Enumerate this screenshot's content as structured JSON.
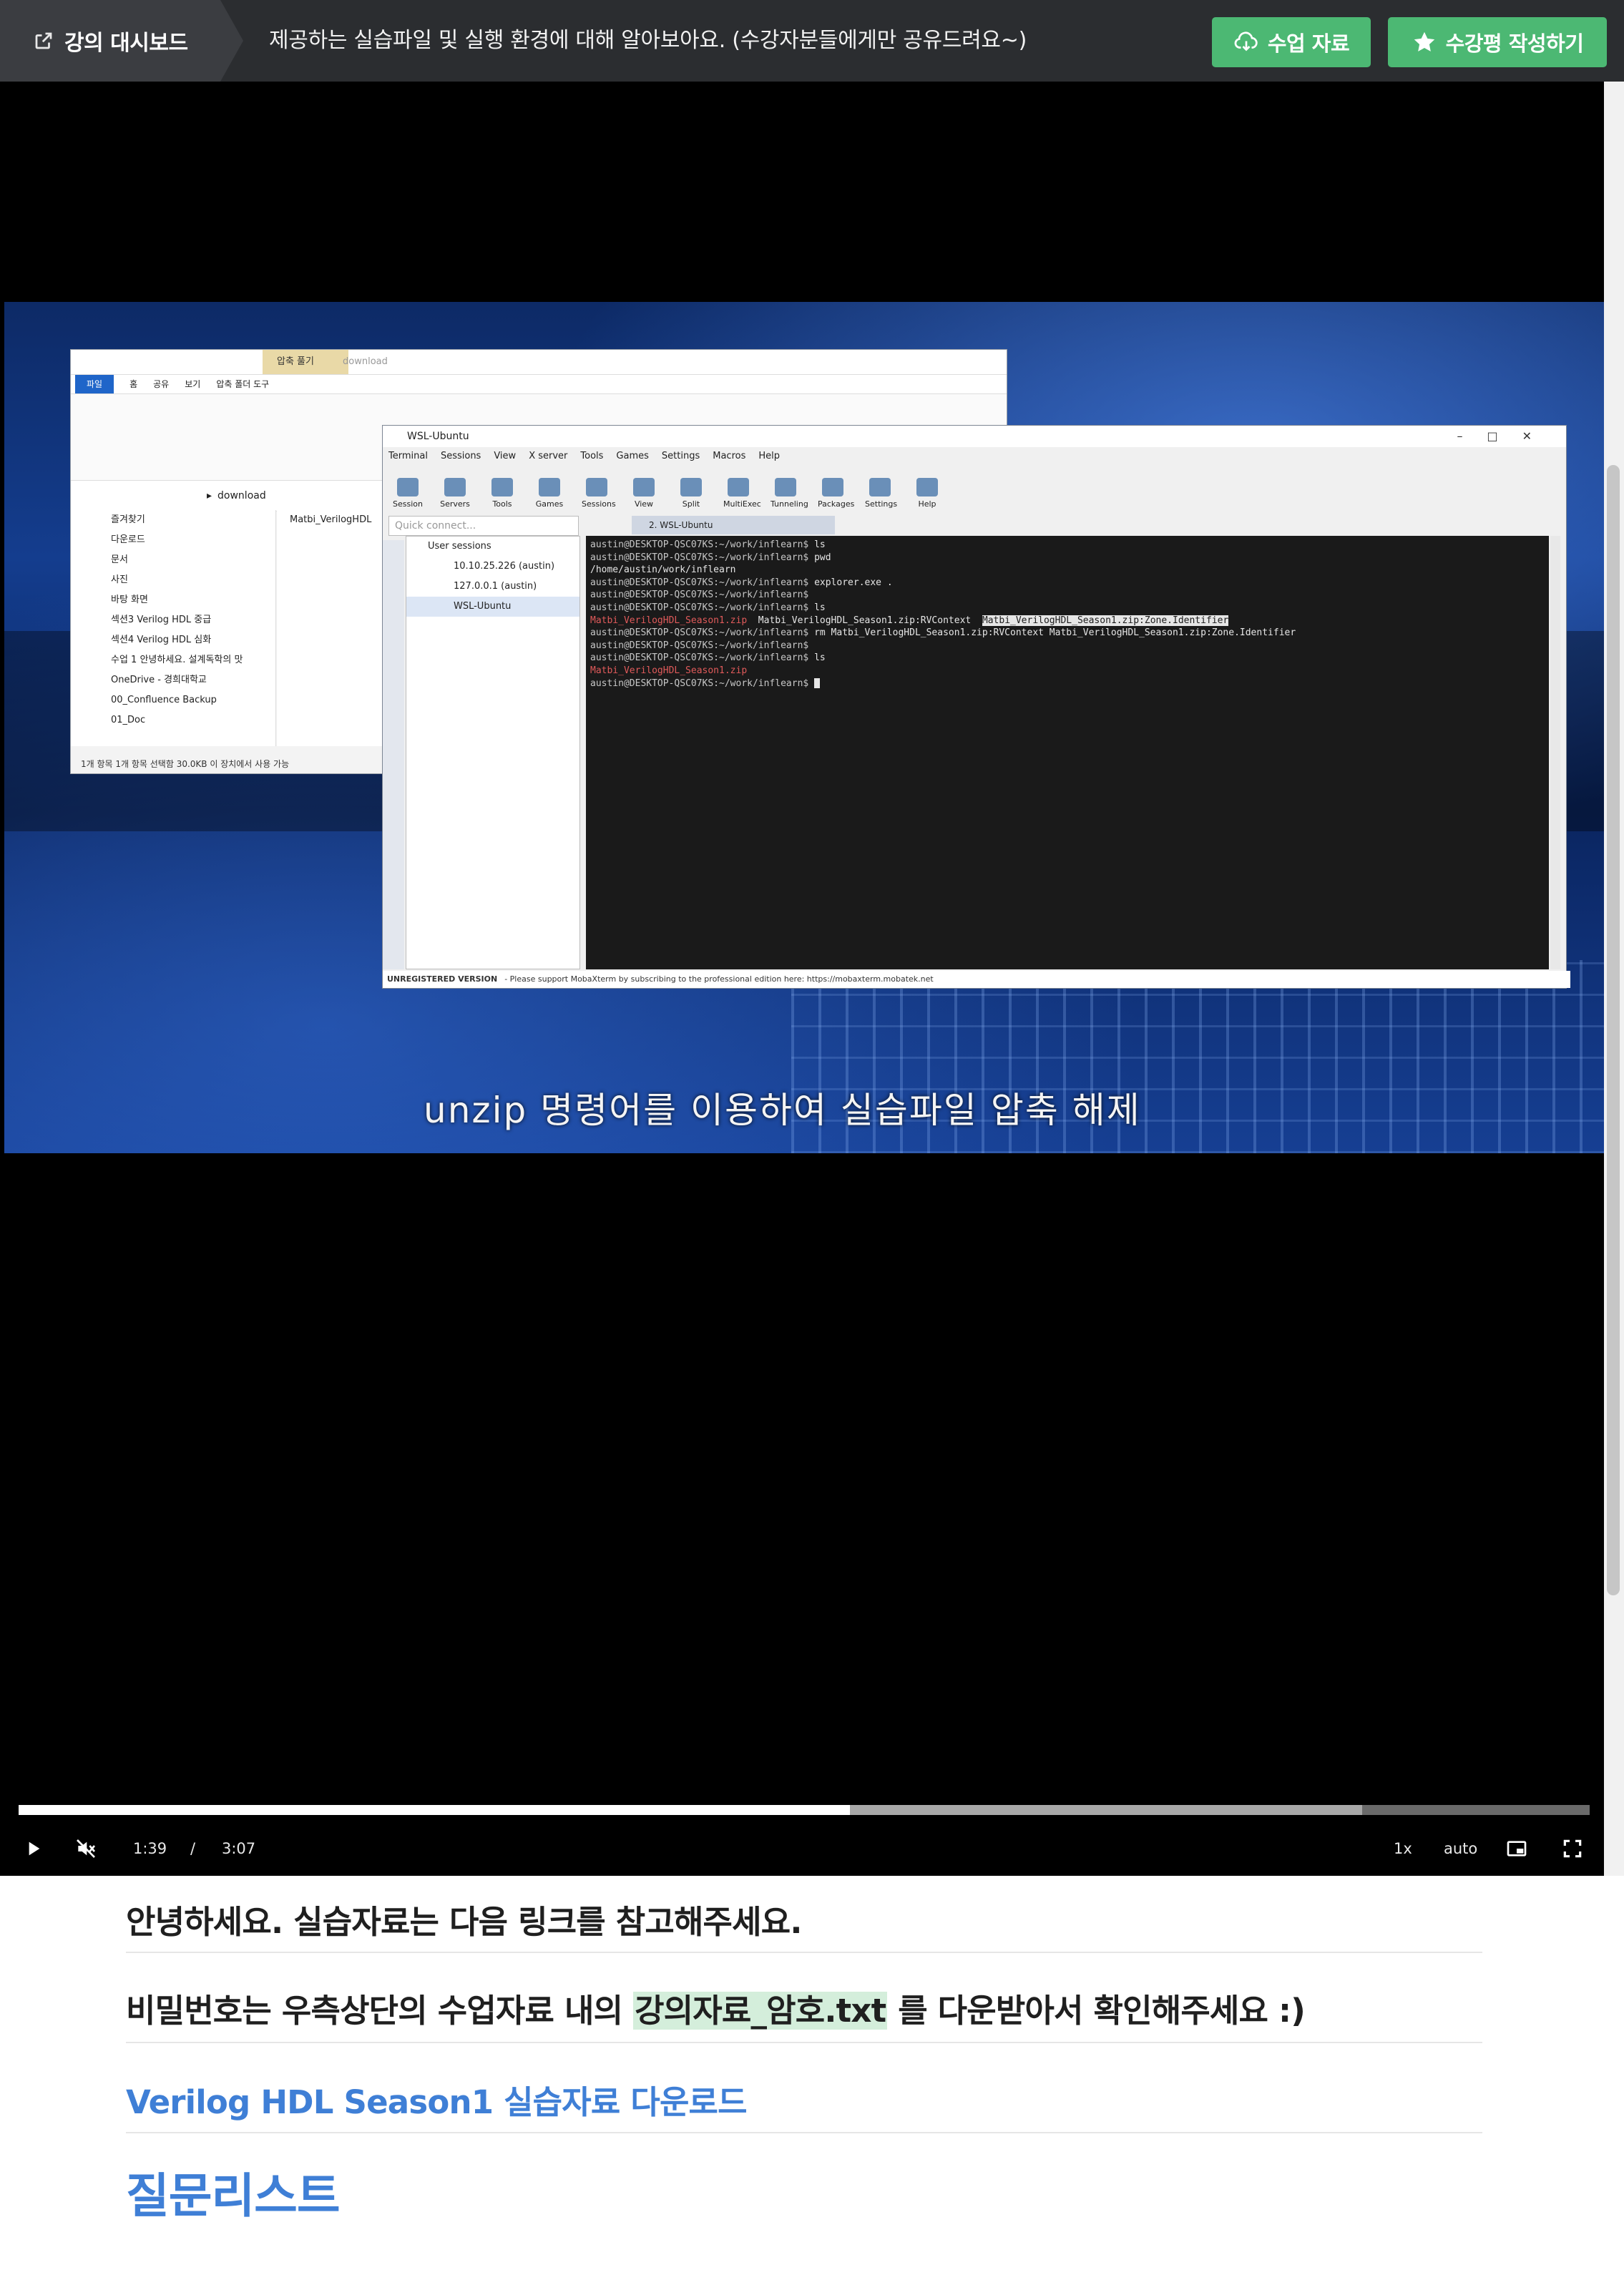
{
  "header": {
    "dashboard_label": "강의 대시보드",
    "lecture_title": "제공하는 실습파일 및 실행 환경에 대해 알아보아요. (수강자분들에게만 공유드려요~)",
    "materials_button": "수업 자료",
    "review_button": "수강평 작성하기",
    "accent_color": "#4cb873"
  },
  "video": {
    "subtitle": "unzip 명령어를 이용하여 실습파일 압축 해제",
    "current_time": "1:39",
    "time_separator": "/",
    "duration": "3:07",
    "played_fraction": 0.529,
    "buffered_fraction": 0.855,
    "speed": "1x",
    "quality": "auto",
    "explorer": {
      "context_tab": "압축 풀기",
      "window_title": "download",
      "ribbon_tabs": [
        "파일",
        "홈",
        "공유",
        "보기",
        "압축 폴더 도구"
      ],
      "address": "download",
      "nav_items": [
        "즐겨찾기",
        "다운로드",
        "문서",
        "사진",
        "바탕 화면",
        "섹션3 Verilog HDL 중급",
        "섹션4 Verilog HDL 심화",
        "수업 1 안녕하세요. 설계독학의 맛",
        "OneDrive - 경희대학교",
        "00_Confluence Backup",
        "01_Doc"
      ],
      "file_name": "Matbi_VerilogHDL",
      "status": "1개 항목    1개 항목 선택함 30.0KB    이 장치에서 사용 가능"
    },
    "moba": {
      "window_title": "WSL-Ubuntu",
      "menus": [
        "Terminal",
        "Sessions",
        "View",
        "X server",
        "Tools",
        "Games",
        "Settings",
        "Macros",
        "Help"
      ],
      "tools": [
        "Session",
        "Servers",
        "Tools",
        "Games",
        "Sessions",
        "View",
        "Split",
        "MultiExec",
        "Tunneling",
        "Packages",
        "Settings",
        "Help"
      ],
      "quick_connect": "Quick connect...",
      "tab_label": "2. WSL-Ubuntu",
      "sessions_header": "User sessions",
      "sessions": [
        "10.10.25.226 (austin)",
        "127.0.0.1 (austin)",
        "WSL-Ubuntu"
      ],
      "prompt": "austin@DESKTOP-QSC07KS:~/work/inflearn$",
      "terminal_lines": [
        {
          "cmd": "ls"
        },
        {
          "cmd": "pwd"
        },
        {
          "out": "/home/austin/work/inflearn"
        },
        {
          "cmd": "explorer.exe ."
        },
        {
          "cmd": ""
        },
        {
          "cmd": "ls"
        },
        {
          "ls_red": "Matbi_VerilogHDL_Season1.zip",
          "ls_plain": "Matbi_VerilogHDL_Season1.zip:RVContext",
          "ls_hl": "Matbi_VerilogHDL_Season1.zip:Zone.Identifier"
        },
        {
          "cmd": "rm Matbi_VerilogHDL_Season1.zip:RVContext Matbi_VerilogHDL_Season1.zip:Zone.Identifier"
        },
        {
          "cmd": ""
        },
        {
          "cmd": "ls"
        },
        {
          "red": "Matbi_VerilogHDL_Season1.zip"
        },
        {
          "cmd": "",
          "cursor": true
        }
      ],
      "status_bold": "UNREGISTERED VERSION",
      "status_text": "-  Please support MobaXterm by subscribing to the professional edition here:  https://mobaxterm.mobatek.net"
    }
  },
  "notes": {
    "line1": "안녕하세요. 실습자료는 다음 링크를 참고해주세요.",
    "line2_before": "비밀번호는 우측상단의 수업자료 내의 ",
    "line2_highlight": "강의자료_암호.txt",
    "line2_after": " 를 다운받아서 확인해주세요 :)",
    "download_link": "Verilog HDL Season1 실습자료 다운로드",
    "questions_heading": "질문리스트",
    "link_color": "#3f7fd6"
  }
}
